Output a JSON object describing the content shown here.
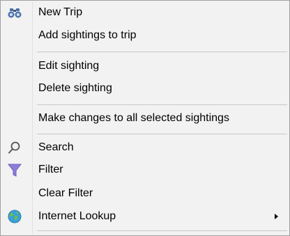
{
  "menu": {
    "items": [
      {
        "label": "New Trip",
        "icon": "binoculars-icon"
      },
      {
        "label": "Add sightings to trip",
        "icon": null
      },
      {
        "label": "Edit sighting",
        "icon": null
      },
      {
        "label": "Delete sighting",
        "icon": null
      },
      {
        "label": "Make changes to all selected sightings",
        "icon": null
      },
      {
        "label": "Search",
        "icon": "magnifier-icon"
      },
      {
        "label": "Filter",
        "icon": "funnel-icon"
      },
      {
        "label": "Clear Filter",
        "icon": null
      },
      {
        "label": "Internet Lookup",
        "icon": "globe-icon",
        "has_submenu": true
      }
    ]
  },
  "colors": {
    "background": "#f2f2f2",
    "separator": "#c8c8c8",
    "border": "#a0a0a0",
    "funnel": "#8a7fd6",
    "binoculars": "#4a6fa5",
    "globe": "#3aa0d8"
  }
}
